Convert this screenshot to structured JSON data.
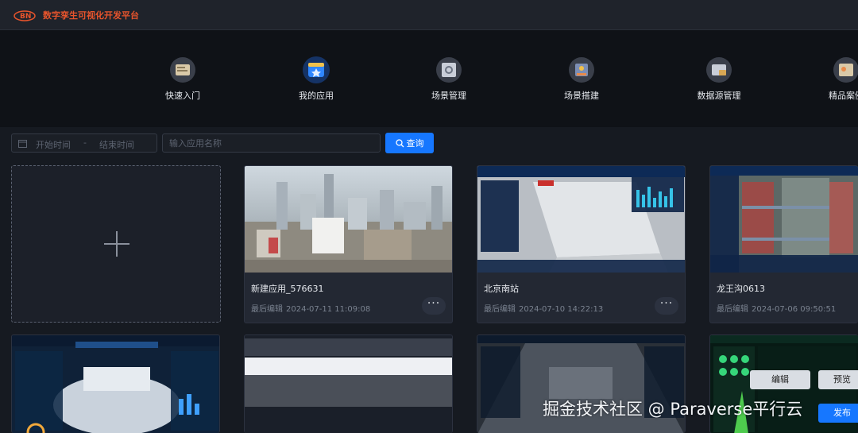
{
  "app": {
    "title": "数字孪生可视化开发平台",
    "logo_text": "BN"
  },
  "nav": [
    {
      "label": "快速入门",
      "icon": "quick-start-icon"
    },
    {
      "label": "我的应用",
      "icon": "my-apps-icon",
      "active": true
    },
    {
      "label": "场景管理",
      "icon": "scene-manage-icon"
    },
    {
      "label": "场景搭建",
      "icon": "scene-build-icon"
    },
    {
      "label": "数据源管理",
      "icon": "datasource-icon"
    },
    {
      "label": "精品案例",
      "icon": "showcase-icon"
    }
  ],
  "filters": {
    "start_placeholder": "开始时间",
    "separator": "-",
    "end_placeholder": "结束时间",
    "name_placeholder": "输入应用名称",
    "search_label": "查询"
  },
  "cards_row1": [
    {
      "name": "新建应用_576631",
      "meta_label": "最后编辑",
      "time": "2024-07-11 11:09:08",
      "more": "···"
    },
    {
      "name": "北京南站",
      "meta_label": "最后编辑",
      "time": "2024-07-10 14:22:13",
      "more": "···"
    },
    {
      "name": "龙王沟0613",
      "meta_label": "最后编辑",
      "time": "2024-07-06 09:50:51",
      "more": "···"
    }
  ],
  "hover_actions": {
    "edit": "编辑",
    "preview": "预览",
    "publish": "发布"
  },
  "watermark": "掘金技术社区 @ Paraverse平行云",
  "colors": {
    "accent": "#1677ff",
    "brand": "#e8542c",
    "background": "#161a21"
  }
}
